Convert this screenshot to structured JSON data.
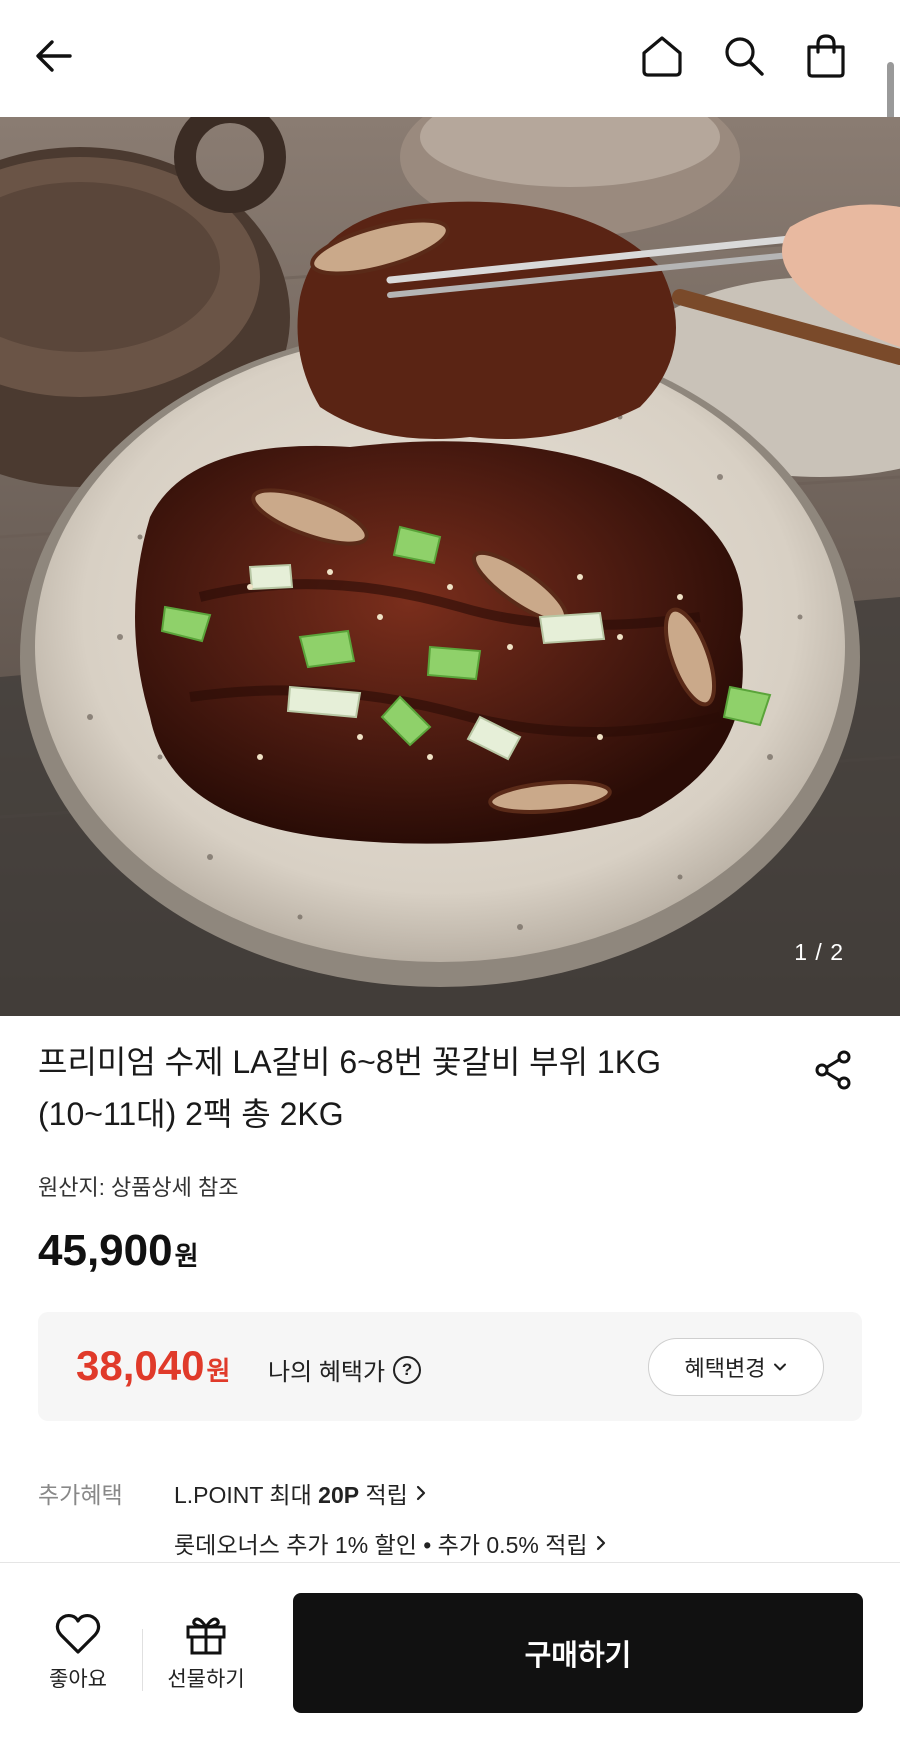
{
  "header": {
    "back_icon": "arrow-left-icon",
    "home_icon": "home-icon",
    "search_icon": "search-icon",
    "cart_icon": "shopping-bag-icon"
  },
  "gallery": {
    "pager": "1 / 2"
  },
  "product": {
    "title_line1": "프리미엄 수제 LA갈비 6~8번 꽃갈비 부위 1KG",
    "title_line2": "(10~11대) 2팩 총 2KG",
    "origin": "원산지: 상품상세 참조",
    "price": "45,900",
    "price_unit": "원"
  },
  "benefit": {
    "price": "38,040",
    "price_unit": "원",
    "label": "나의 혜택가",
    "help": "?",
    "change_button": "혜택변경"
  },
  "extra": {
    "label": "추가혜택",
    "line1_prefix": "L.POINT 최대 ",
    "line1_bold": "20P",
    "line1_suffix": " 적립",
    "line2": "롯데오너스 추가 1% 할인 • 추가 0.5% 적립"
  },
  "bottom": {
    "like_label": "좋아요",
    "gift_label": "선물하기",
    "buy_label": "구매하기"
  },
  "colors": {
    "accent_red": "#e03a2a",
    "button_black": "#111111"
  }
}
